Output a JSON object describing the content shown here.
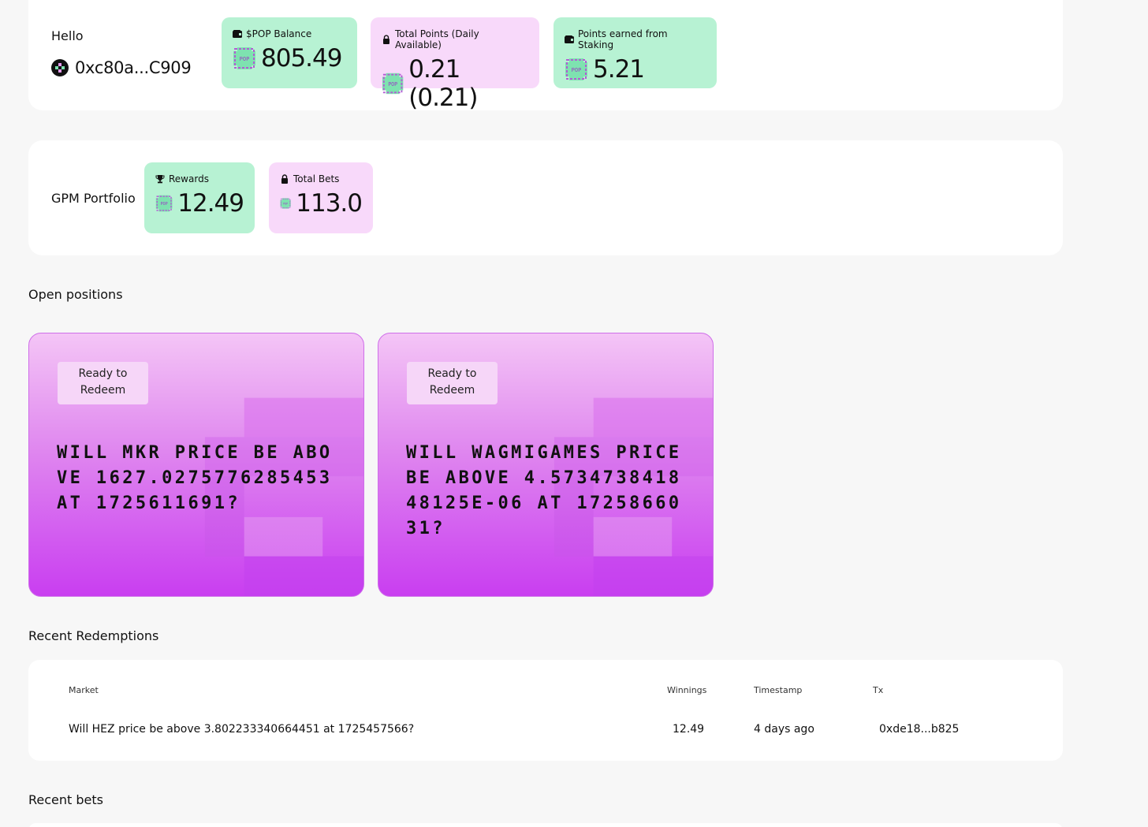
{
  "header": {
    "hello_label": "Hello",
    "address": "0xc80a...C909"
  },
  "stats": [
    {
      "icon": "wallet-icon",
      "label": "$POP Balance",
      "value": "805.49",
      "color": "#b7f2d3"
    },
    {
      "icon": "lock-icon",
      "label": "Total Points (Daily Available)",
      "value": "0.21 (0.21)",
      "color": "#f8d9fa"
    },
    {
      "icon": "wallet-icon",
      "label": "Points earned from Staking",
      "value": "5.21",
      "color": "#b7f2d3"
    }
  ],
  "portfolio": {
    "label": "GPM Portfolio",
    "cards": [
      {
        "icon": "trophy-icon",
        "label": "Rewards",
        "value": "12.49",
        "color": "#b7f2d3"
      },
      {
        "icon": "lock-icon",
        "label": "Total Bets",
        "value": "113.0",
        "color": "#f8d9fa"
      }
    ]
  },
  "open_positions": {
    "title": "Open positions",
    "cards": [
      {
        "status": "Ready to Redeem",
        "question": "Will MKR price be above 1627.0275776285453 at 1725611691?"
      },
      {
        "status": "Ready to Redeem",
        "question": "Will WAGMIGAMES price be above 4.573473841848125e-06 at 1725866031?"
      }
    ]
  },
  "redemptions": {
    "title": "Recent Redemptions",
    "columns": [
      "Market",
      "Winnings",
      "Timestamp",
      "Tx"
    ],
    "rows": [
      {
        "market": "Will HEZ price be above 3.802233340664451 at 1725457566?",
        "winnings": "12.49",
        "timestamp": "4 days ago",
        "tx": "0xde18...b825"
      }
    ]
  },
  "bets": {
    "title": "Recent bets"
  },
  "colors": {
    "green_card": "#b7f2d3",
    "pink_card": "#f8d9fa",
    "card_gradient_start": "#f4c5f6",
    "card_gradient_end": "#c93ef0"
  }
}
